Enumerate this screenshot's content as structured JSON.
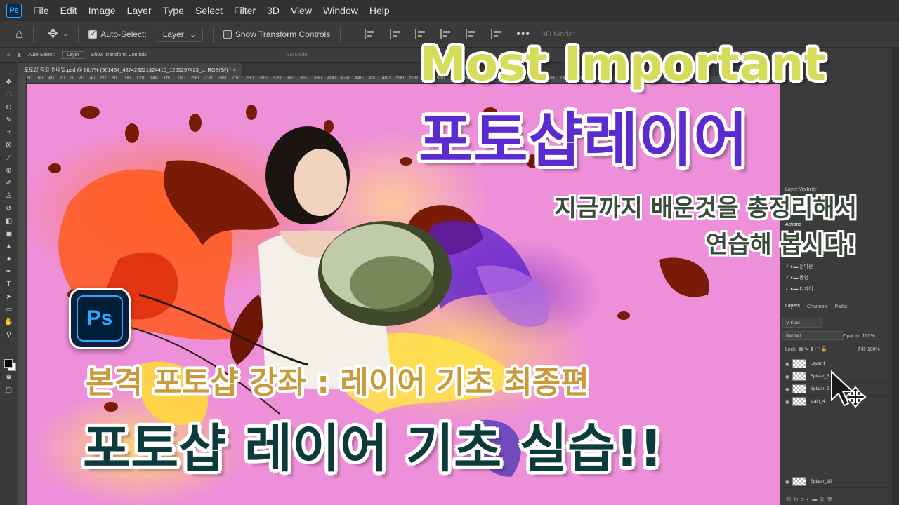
{
  "menubar": {
    "logo": "Ps",
    "items": [
      "File",
      "Edit",
      "Image",
      "Layer",
      "Type",
      "Select",
      "Filter",
      "3D",
      "View",
      "Window",
      "Help"
    ]
  },
  "options_bar": {
    "auto_select_label": "Auto-Select:",
    "auto_select_checked": true,
    "target_value": "Layer",
    "show_transform_label": "Show Transform Controls",
    "show_transform_checked": false,
    "mode3d_label": "3D Mode:"
  },
  "small_options_bar": {
    "auto_select_label": "Auto-Select:",
    "target_value": "Layer",
    "show_transform_label": "Show Transform Controls",
    "mode3d_label": "3D Mode:"
  },
  "document_tab": {
    "title": "포토샵 강좌 썸네일.psd @ 66.7% (901434_487423221324410_1255297423_o, RGB/8#) *"
  },
  "ruler": {
    "ticks": "80    60    40    20    0    20    40    60    80    100    120    140    160    180    200    220    240    260    280    300    320    340    360    380    400    420    440    460    480    500    520    540    560    580    600    620    640    660    680    700    720    740    760    780    800    820"
  },
  "layers_panel": {
    "tabs": [
      "Layers",
      "Channels",
      "Paths"
    ],
    "filter_kind": "Kind",
    "blend_mode": "Normal",
    "opacity_label": "Opacity:",
    "opacity_value": "100%",
    "lock_label": "Lock:",
    "fill_label": "Fill:",
    "fill_value": "100%",
    "layers": [
      "Layer 1",
      "Splash_3",
      "Splash_2",
      "stain_4"
    ],
    "extra_layer": "Splash_10"
  },
  "upper_panel": {
    "layer_visible_label": "Layer Visibility",
    "actions_label": "Actions",
    "action_items": [
      "온다운",
      "동영",
      "디자이"
    ]
  },
  "thumbnail": {
    "headline_en": "Most Important",
    "headline_ko": "포토샵레이어",
    "subtitle_line1": "지금까지 배운것을 총정리해서",
    "subtitle_line2": "연습해 봅시다!",
    "course_label": "본격 포토샵 강좌 : 레이어 기초 최종편",
    "main_title": "포토샵 레이어 기초 실습!!",
    "badge": "Ps"
  },
  "colors": {
    "canvas_pink": "#ee8fd9",
    "headline_yellow": "#d4dc5a",
    "headline_purple": "#5b2bd0",
    "course_gold": "#c99a3c",
    "main_dark_teal": "#0d3b3b",
    "ps_blue": "#31a8ff"
  }
}
